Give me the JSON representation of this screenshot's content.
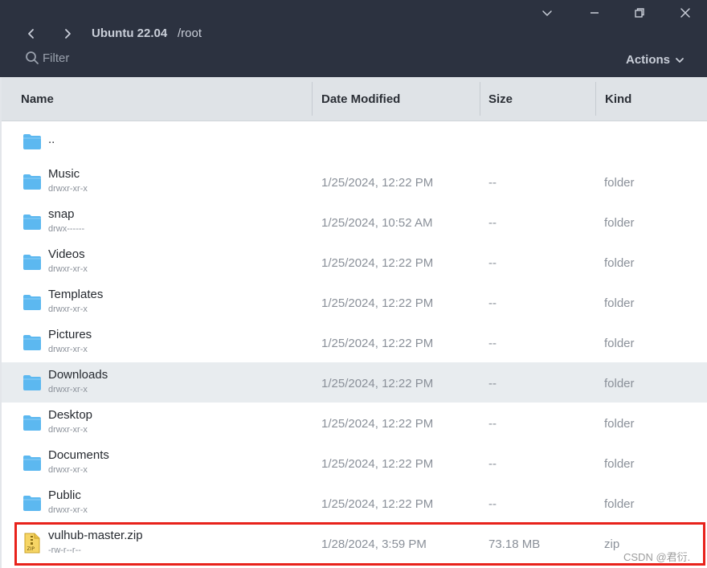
{
  "titlebar": {
    "host": "Ubuntu 22.04",
    "path": "/root",
    "filter_placeholder": "Filter",
    "actions_label": "Actions",
    "bg_color": "#2c3240"
  },
  "columns": {
    "name": "Name",
    "date": "Date Modified",
    "size": "Size",
    "kind": "Kind"
  },
  "files": [
    {
      "name": "..",
      "perm": "",
      "date": "",
      "size": "",
      "kind": "",
      "icon": "folder-icon"
    },
    {
      "name": "Music",
      "perm": "drwxr-xr-x",
      "date": "1/25/2024, 12:22 PM",
      "size": "--",
      "kind": "folder",
      "icon": "folder-icon"
    },
    {
      "name": "snap",
      "perm": "drwx------",
      "date": "1/25/2024, 10:52 AM",
      "size": "--",
      "kind": "folder",
      "icon": "folder-icon"
    },
    {
      "name": "Videos",
      "perm": "drwxr-xr-x",
      "date": "1/25/2024, 12:22 PM",
      "size": "--",
      "kind": "folder",
      "icon": "folder-icon"
    },
    {
      "name": "Templates",
      "perm": "drwxr-xr-x",
      "date": "1/25/2024, 12:22 PM",
      "size": "--",
      "kind": "folder",
      "icon": "folder-icon"
    },
    {
      "name": "Pictures",
      "perm": "drwxr-xr-x",
      "date": "1/25/2024, 12:22 PM",
      "size": "--",
      "kind": "folder",
      "icon": "folder-icon"
    },
    {
      "name": "Downloads",
      "perm": "drwxr-xr-x",
      "date": "1/25/2024, 12:22 PM",
      "size": "--",
      "kind": "folder",
      "icon": "folder-icon",
      "highlighted": true
    },
    {
      "name": "Desktop",
      "perm": "drwxr-xr-x",
      "date": "1/25/2024, 12:22 PM",
      "size": "--",
      "kind": "folder",
      "icon": "folder-icon"
    },
    {
      "name": "Documents",
      "perm": "drwxr-xr-x",
      "date": "1/25/2024, 12:22 PM",
      "size": "--",
      "kind": "folder",
      "icon": "folder-icon"
    },
    {
      "name": "Public",
      "perm": "drwxr-xr-x",
      "date": "1/25/2024, 12:22 PM",
      "size": "--",
      "kind": "folder",
      "icon": "folder-icon"
    },
    {
      "name": "vulhub-master.zip",
      "perm": "-rw-r--r--",
      "date": "1/28/2024, 3:59 PM",
      "size": "73.18 MB",
      "kind": "zip",
      "icon": "zip-file-icon"
    }
  ],
  "colors": {
    "folder": "#5cb8f0",
    "highlight_row": "#e8ecef",
    "annotation_box": "#e8221b"
  },
  "watermark": "CSDN @君衍."
}
